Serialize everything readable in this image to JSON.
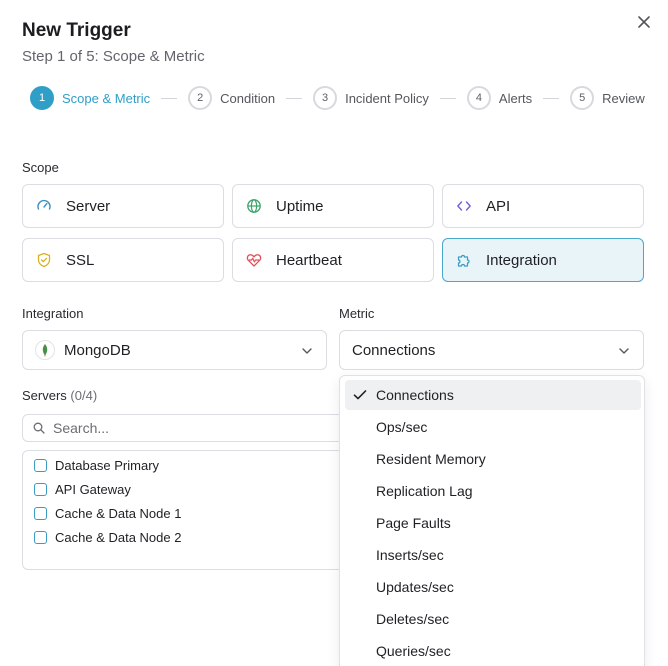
{
  "dialog": {
    "title": "New Trigger",
    "subtitle": "Step 1 of 5: Scope & Metric"
  },
  "steps": [
    {
      "num": "1",
      "label": "Scope & Metric",
      "active": true
    },
    {
      "num": "2",
      "label": "Condition"
    },
    {
      "num": "3",
      "label": "Incident Policy"
    },
    {
      "num": "4",
      "label": "Alerts"
    },
    {
      "num": "5",
      "label": "Review"
    }
  ],
  "scope": {
    "label": "Scope",
    "options": [
      {
        "label": "Server",
        "icon": "gauge-icon"
      },
      {
        "label": "Uptime",
        "icon": "globe-icon"
      },
      {
        "label": "API",
        "icon": "code-icon"
      },
      {
        "label": "SSL",
        "icon": "shield-check-icon"
      },
      {
        "label": "Heartbeat",
        "icon": "heart-pulse-icon"
      },
      {
        "label": "Integration",
        "icon": "puzzle-icon",
        "selected": true
      }
    ]
  },
  "integration": {
    "label": "Integration",
    "value": "MongoDB",
    "icon": "mongodb-leaf-icon"
  },
  "metric": {
    "label": "Metric",
    "value": "Connections",
    "options": [
      "Connections",
      "Ops/sec",
      "Resident Memory",
      "Replication Lag",
      "Page Faults",
      "Inserts/sec",
      "Updates/sec",
      "Deletes/sec",
      "Queries/sec"
    ],
    "selected": "Connections"
  },
  "servers": {
    "label": "Servers",
    "count": "(0/4)",
    "search_placeholder": "Search...",
    "items": [
      "Database Primary",
      "API Gateway",
      "Cache & Data Node 1",
      "Cache & Data Node 2"
    ]
  },
  "colors": {
    "accent": "#2f9fc8",
    "selected_card_bg": "#e9f4f8",
    "mongodb_green": "#3a9a4a",
    "heartbeat_red": "#e0505a",
    "ssl_yellow": "#d8b21f"
  }
}
